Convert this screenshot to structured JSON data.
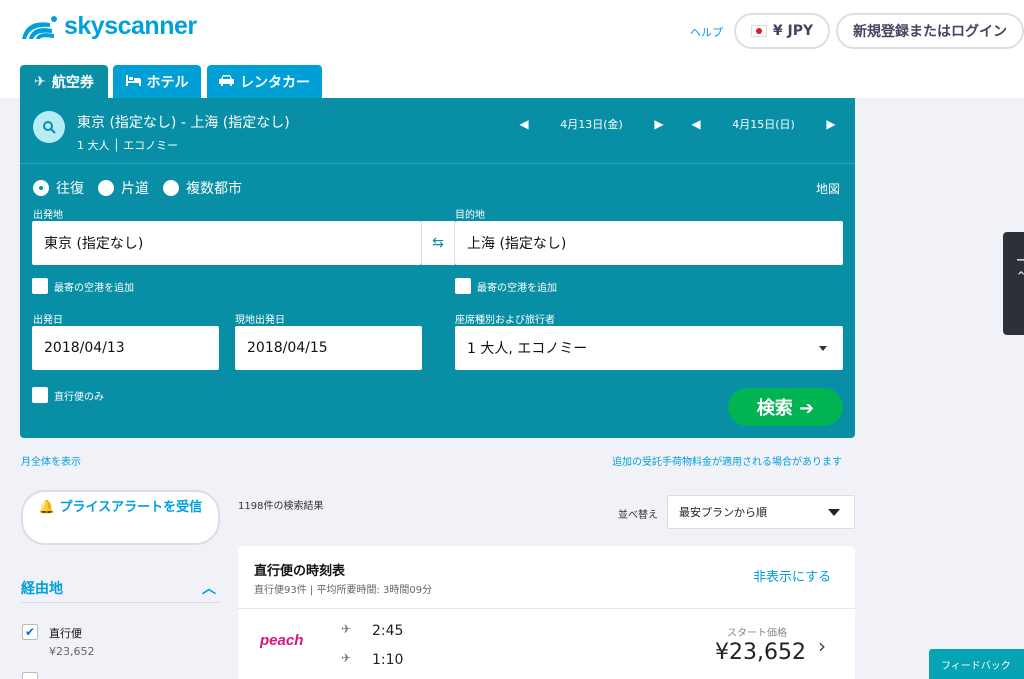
{
  "header": {
    "brand": "skyscanner",
    "help": "ヘルプ",
    "currency": "¥ JPY",
    "login": "新規登録またはログイン"
  },
  "tabs": [
    {
      "label": "航空券",
      "icon": "plane-icon"
    },
    {
      "label": "ホテル",
      "icon": "bed-icon"
    },
    {
      "label": "レンタカー",
      "icon": "car-icon"
    }
  ],
  "summary": {
    "route": "東京 (指定なし) - 上海 (指定なし)",
    "travelers": "1 大人",
    "cabin": "エコノミー",
    "depart_date": "4月13日(金)",
    "return_date": "4月15日(日)"
  },
  "trip_types": {
    "round": "往復",
    "oneway": "片道",
    "multi": "複数都市"
  },
  "map_link": "地図",
  "form": {
    "origin_label": "出発地",
    "origin_value": "東京 (指定なし)",
    "dest_label": "目的地",
    "dest_value": "上海 (指定なし)",
    "nearby_origin": "最寄の空港を追加",
    "nearby_dest": "最寄の空港を追加",
    "depart_label": "出発日",
    "depart_value": "2018/04/13",
    "return_label": "現地出発日",
    "return_value": "2018/04/15",
    "cabin_label": "座席種別および旅行者",
    "cabin_value": "1 大人, エコノミー",
    "direct_only": "直行便のみ",
    "search": "検索 ➔"
  },
  "links": {
    "whole_month": "月全体を表示",
    "baggage_note": "追加の受託手荷物料金が適用される場合があります"
  },
  "sidebar": {
    "alert_button": "プライスアラートを受信",
    "filter_title": "経由地",
    "direct_label": "直行便",
    "direct_price": "¥23,652"
  },
  "results": {
    "count": "1198件の検索結果",
    "sort_label": "並べ替え",
    "sort_value": "最安プランから順"
  },
  "card": {
    "title": "直行便の時刻表",
    "subtitle": "直行便93件 | 平均所要時間: 3時間09分",
    "hide": "非表示にする",
    "airline": "peach",
    "time_out": "2:45",
    "time_back": "1:10",
    "start_label": "スタート価格",
    "price": "¥23,652"
  },
  "feedback": "フィードバック",
  "colors": {
    "panel": "#088fa6",
    "brand": "#00a0dd",
    "search_button": "#00b551",
    "peach": "#d4157f"
  }
}
